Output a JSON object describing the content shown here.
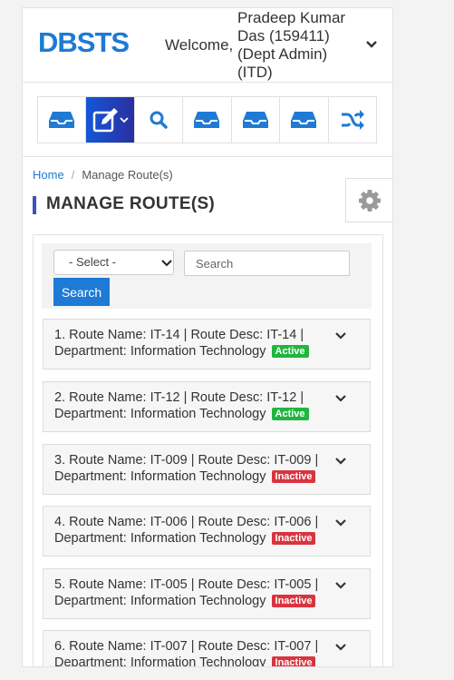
{
  "header": {
    "logo": "DBSTS",
    "welcome": "Welcome,",
    "user_name": "Pradeep Kumar Das (159411) (Dept Admin) (ITD)"
  },
  "toolbar": {
    "icons": [
      "inbox-icon",
      "edit-icon",
      "search-icon",
      "inbox-icon",
      "inbox-icon",
      "inbox-icon",
      "shuffle-icon"
    ]
  },
  "breadcrumb": {
    "home": "Home",
    "current": "Manage Route(s)"
  },
  "page": {
    "title": "MANAGE ROUTE(S)"
  },
  "filter": {
    "select_value": "- Select -",
    "search_placeholder": "Search",
    "search_button": "Search"
  },
  "routes": [
    {
      "line1": "1. Route Name: IT-14 | Route Desc: IT-14 |",
      "line2": "Department: Information Technology",
      "status": "Active"
    },
    {
      "line1": "2. Route Name: IT-12 | Route Desc: IT-12 |",
      "line2": "Department: Information Technology",
      "status": "Active"
    },
    {
      "line1": "3. Route Name: IT-009 | Route Desc: IT-009 |",
      "line2": "Department: Information Technology",
      "status": "Inactive"
    },
    {
      "line1": "4. Route Name: IT-006 | Route Desc: IT-006 |",
      "line2": "Department: Information Technology",
      "status": "Inactive"
    },
    {
      "line1": "5. Route Name: IT-005 | Route Desc: IT-005 |",
      "line2": "Department: Information Technology",
      "status": "Inactive"
    },
    {
      "line1": "6. Route Name: IT-007 | Route Desc: IT-007 |",
      "line2": "Department: Information Technology",
      "status": "Inactive"
    }
  ],
  "colors": {
    "brand": "#1e7ad4",
    "active": "#21b53f",
    "inactive": "#d9343f"
  }
}
